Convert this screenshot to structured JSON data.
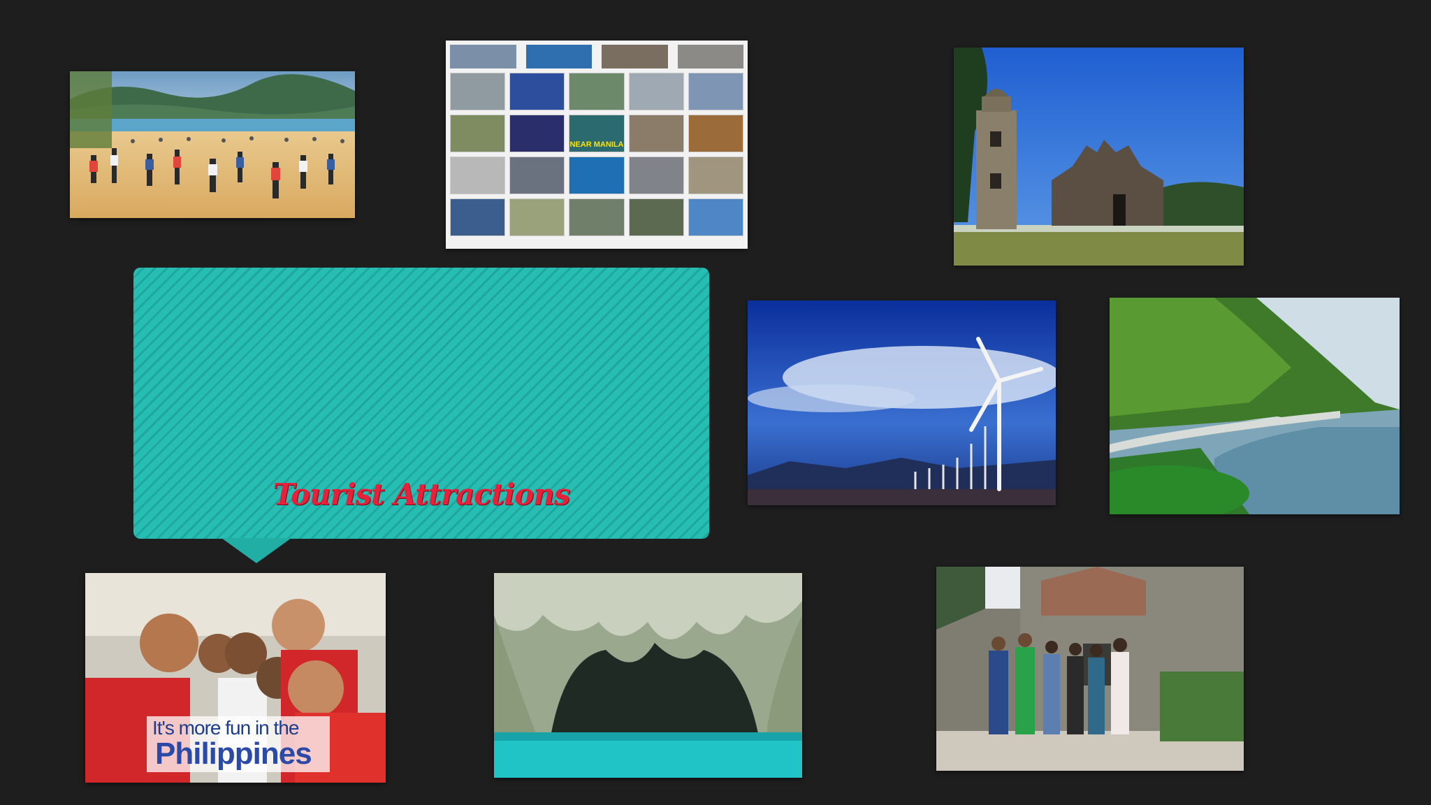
{
  "slide": {
    "background_color": "#1e1e1e",
    "callout": {
      "title": "Tourist Attractions",
      "fill_color": "#26bdb2",
      "title_color": "#e8203a"
    },
    "photos": [
      {
        "subject": "crowded-beach-photo"
      },
      {
        "subject": "attractions-collage-photo"
      },
      {
        "subject": "baroque-church-photo"
      },
      {
        "subject": "wind-farm-photo"
      },
      {
        "subject": "coastal-viaduct-photo"
      },
      {
        "subject": "its-more-fun-photo"
      },
      {
        "subject": "underground-river-cave-photo"
      },
      {
        "subject": "fort-group-photo"
      }
    ],
    "collage": {
      "near_manila_label": "NEAR MANILA"
    },
    "fun_banner": {
      "line1": "It's more fun in the",
      "line2": "Philippines"
    }
  }
}
